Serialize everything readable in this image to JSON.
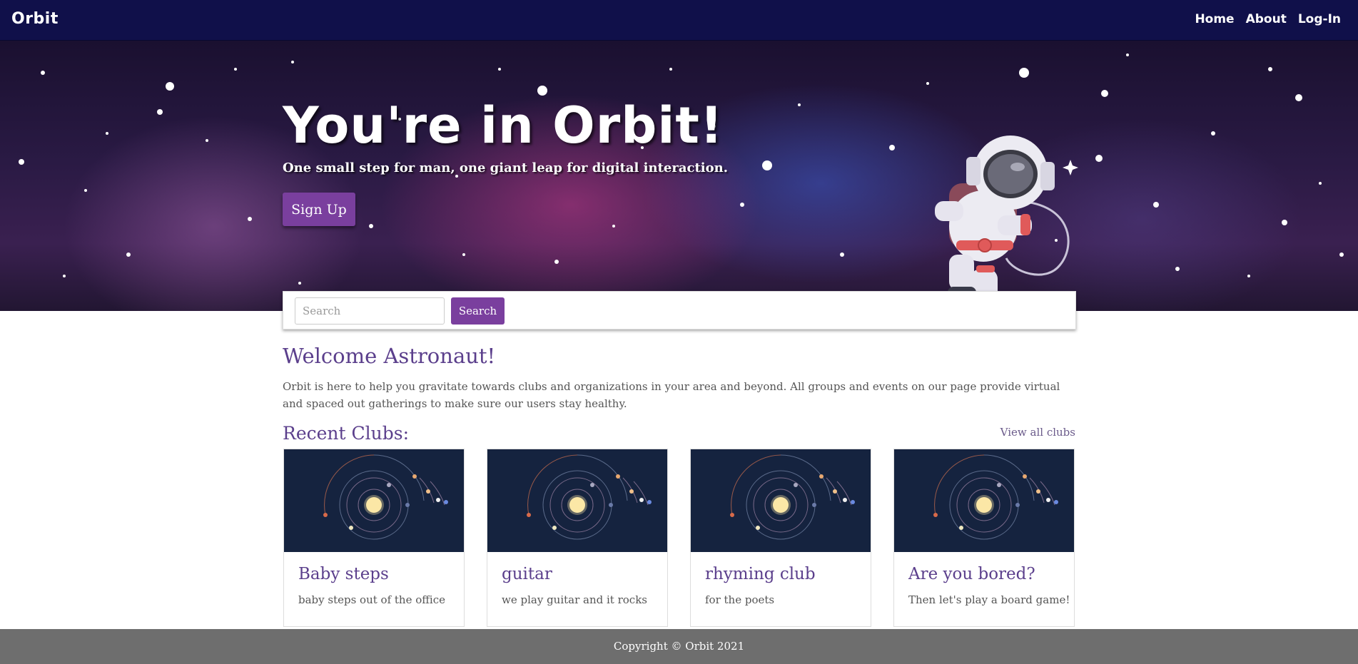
{
  "navbar": {
    "brand": "Orbit",
    "links": [
      "Home",
      "About",
      "Log-In"
    ]
  },
  "hero": {
    "title": "You're in Orbit!",
    "subtitle": "One small step for man, one giant leap for digital interaction.",
    "signup_label": "Sign Up"
  },
  "search": {
    "placeholder": "Search",
    "value": "",
    "button_label": "Search"
  },
  "welcome": {
    "title": "Welcome Astronaut!",
    "text": "Orbit is here to help you gravitate towards clubs and organizations in your area and beyond. All groups and events on our page provide virtual and spaced out gatherings to make sure our users stay healthy."
  },
  "recent": {
    "title": "Recent Clubs:",
    "view_all_label": "View all clubs",
    "clubs": [
      {
        "title": "Baby steps",
        "description": "baby steps out of the office"
      },
      {
        "title": "guitar",
        "description": "we play guitar and it rocks"
      },
      {
        "title": "rhyming club",
        "description": "for the poets"
      },
      {
        "title": "Are you bored?",
        "description": "Then let's play a board game!"
      }
    ]
  },
  "footer": {
    "text": "Copyright © Orbit 2021"
  },
  "colors": {
    "navbar": "#10104a",
    "accent": "#7a3f9e",
    "heading": "#5b3f8c",
    "card_image_bg": "#15233f",
    "footer": "#6e6e6e"
  },
  "icons": [
    "astronaut-illustration",
    "solar-system-illustration"
  ]
}
